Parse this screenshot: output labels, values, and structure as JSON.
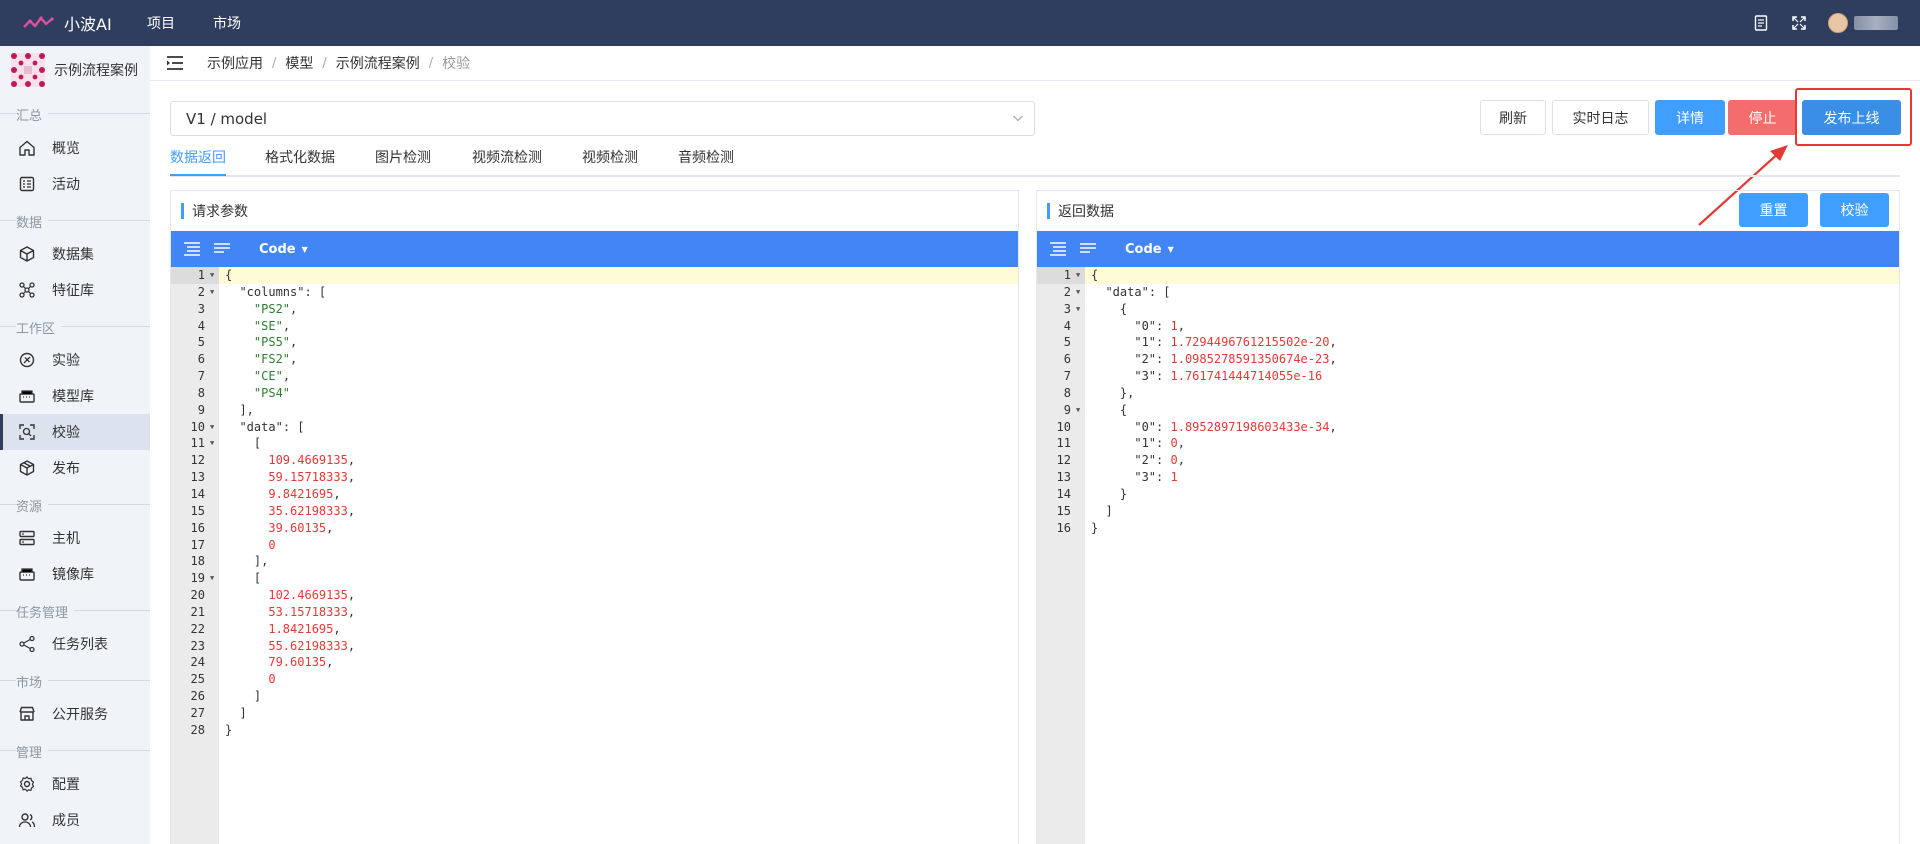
{
  "topbar": {
    "brand": "小波AI",
    "nav": [
      "项目",
      "市场"
    ],
    "icons": [
      "document-icon",
      "fullscreen-icon"
    ]
  },
  "sidebar": {
    "project_name": "示例流程案例",
    "groups": [
      {
        "title": "汇总",
        "items": [
          {
            "label": "概览",
            "icon": "home-icon"
          },
          {
            "label": "活动",
            "icon": "activity-icon"
          }
        ]
      },
      {
        "title": "数据",
        "items": [
          {
            "label": "数据集",
            "icon": "cube-icon"
          },
          {
            "label": "特征库",
            "icon": "feature-icon"
          }
        ]
      },
      {
        "title": "工作区",
        "items": [
          {
            "label": "实验",
            "icon": "experiment-icon"
          },
          {
            "label": "模型库",
            "icon": "model-icon"
          },
          {
            "label": "校验",
            "icon": "scan-icon"
          },
          {
            "label": "发布",
            "icon": "publish-icon"
          }
        ]
      },
      {
        "title": "资源",
        "items": [
          {
            "label": "主机",
            "icon": "server-icon"
          },
          {
            "label": "镜像库",
            "icon": "image-repo-icon"
          }
        ]
      },
      {
        "title": "任务管理",
        "items": [
          {
            "label": "任务列表",
            "icon": "tasks-icon"
          }
        ]
      },
      {
        "title": "市场",
        "items": [
          {
            "label": "公开服务",
            "icon": "store-icon"
          }
        ]
      },
      {
        "title": "管理",
        "items": [
          {
            "label": "配置",
            "icon": "settings-icon"
          },
          {
            "label": "成员",
            "icon": "members-icon"
          }
        ]
      }
    ],
    "active_item": "校验"
  },
  "breadcrumb": [
    "示例应用",
    "模型",
    "示例流程案例",
    "校验"
  ],
  "model_select": {
    "value": "V1 / model"
  },
  "actions": {
    "refresh": "刷新",
    "live_log": "实时日志",
    "details": "详情",
    "stop": "停止",
    "publish": "发布上线"
  },
  "tabs": [
    "数据返回",
    "格式化数据",
    "图片检测",
    "视频流检测",
    "视频检测",
    "音频检测"
  ],
  "request_panel": {
    "title": "请求参数",
    "toolbar_mode": "Code",
    "lines": [
      [
        {
          "t": "p",
          "v": "{"
        }
      ],
      [
        {
          "t": "p",
          "v": "  "
        },
        {
          "t": "k",
          "v": "\"columns\""
        },
        {
          "t": "p",
          "v": ": ["
        }
      ],
      [
        {
          "t": "p",
          "v": "    "
        },
        {
          "t": "s",
          "v": "\"PS2\""
        },
        {
          "t": "p",
          "v": ","
        }
      ],
      [
        {
          "t": "p",
          "v": "    "
        },
        {
          "t": "s",
          "v": "\"SE\""
        },
        {
          "t": "p",
          "v": ","
        }
      ],
      [
        {
          "t": "p",
          "v": "    "
        },
        {
          "t": "s",
          "v": "\"PS5\""
        },
        {
          "t": "p",
          "v": ","
        }
      ],
      [
        {
          "t": "p",
          "v": "    "
        },
        {
          "t": "s",
          "v": "\"FS2\""
        },
        {
          "t": "p",
          "v": ","
        }
      ],
      [
        {
          "t": "p",
          "v": "    "
        },
        {
          "t": "s",
          "v": "\"CE\""
        },
        {
          "t": "p",
          "v": ","
        }
      ],
      [
        {
          "t": "p",
          "v": "    "
        },
        {
          "t": "s",
          "v": "\"PS4\""
        }
      ],
      [
        {
          "t": "p",
          "v": "  ],"
        }
      ],
      [
        {
          "t": "p",
          "v": "  "
        },
        {
          "t": "k",
          "v": "\"data\""
        },
        {
          "t": "p",
          "v": ": ["
        }
      ],
      [
        {
          "t": "p",
          "v": "    ["
        }
      ],
      [
        {
          "t": "p",
          "v": "      "
        },
        {
          "t": "n",
          "v": "109.4669135"
        },
        {
          "t": "p",
          "v": ","
        }
      ],
      [
        {
          "t": "p",
          "v": "      "
        },
        {
          "t": "n",
          "v": "59.15718333"
        },
        {
          "t": "p",
          "v": ","
        }
      ],
      [
        {
          "t": "p",
          "v": "      "
        },
        {
          "t": "n",
          "v": "9.8421695"
        },
        {
          "t": "p",
          "v": ","
        }
      ],
      [
        {
          "t": "p",
          "v": "      "
        },
        {
          "t": "n",
          "v": "35.62198333"
        },
        {
          "t": "p",
          "v": ","
        }
      ],
      [
        {
          "t": "p",
          "v": "      "
        },
        {
          "t": "n",
          "v": "39.60135"
        },
        {
          "t": "p",
          "v": ","
        }
      ],
      [
        {
          "t": "p",
          "v": "      "
        },
        {
          "t": "n",
          "v": "0"
        }
      ],
      [
        {
          "t": "p",
          "v": "    ],"
        }
      ],
      [
        {
          "t": "p",
          "v": "    ["
        }
      ],
      [
        {
          "t": "p",
          "v": "      "
        },
        {
          "t": "n",
          "v": "102.4669135"
        },
        {
          "t": "p",
          "v": ","
        }
      ],
      [
        {
          "t": "p",
          "v": "      "
        },
        {
          "t": "n",
          "v": "53.15718333"
        },
        {
          "t": "p",
          "v": ","
        }
      ],
      [
        {
          "t": "p",
          "v": "      "
        },
        {
          "t": "n",
          "v": "1.8421695"
        },
        {
          "t": "p",
          "v": ","
        }
      ],
      [
        {
          "t": "p",
          "v": "      "
        },
        {
          "t": "n",
          "v": "55.62198333"
        },
        {
          "t": "p",
          "v": ","
        }
      ],
      [
        {
          "t": "p",
          "v": "      "
        },
        {
          "t": "n",
          "v": "79.60135"
        },
        {
          "t": "p",
          "v": ","
        }
      ],
      [
        {
          "t": "p",
          "v": "      "
        },
        {
          "t": "n",
          "v": "0"
        }
      ],
      [
        {
          "t": "p",
          "v": "    ]"
        }
      ],
      [
        {
          "t": "p",
          "v": "  ]"
        }
      ],
      [
        {
          "t": "p",
          "v": "}"
        }
      ]
    ],
    "fold_lines": [
      1,
      2,
      10,
      11,
      19
    ]
  },
  "response_panel": {
    "title": "返回数据",
    "toolbar_mode": "Code",
    "reset": "重置",
    "validate": "校验",
    "lines": [
      [
        {
          "t": "p",
          "v": "{"
        }
      ],
      [
        {
          "t": "p",
          "v": "  "
        },
        {
          "t": "k",
          "v": "\"data\""
        },
        {
          "t": "p",
          "v": ": ["
        }
      ],
      [
        {
          "t": "p",
          "v": "    {"
        }
      ],
      [
        {
          "t": "p",
          "v": "      "
        },
        {
          "t": "k",
          "v": "\"0\""
        },
        {
          "t": "p",
          "v": ": "
        },
        {
          "t": "n",
          "v": "1"
        },
        {
          "t": "p",
          "v": ","
        }
      ],
      [
        {
          "t": "p",
          "v": "      "
        },
        {
          "t": "k",
          "v": "\"1\""
        },
        {
          "t": "p",
          "v": ": "
        },
        {
          "t": "n",
          "v": "1.7294496761215502e-20"
        },
        {
          "t": "p",
          "v": ","
        }
      ],
      [
        {
          "t": "p",
          "v": "      "
        },
        {
          "t": "k",
          "v": "\"2\""
        },
        {
          "t": "p",
          "v": ": "
        },
        {
          "t": "n",
          "v": "1.0985278591350674e-23"
        },
        {
          "t": "p",
          "v": ","
        }
      ],
      [
        {
          "t": "p",
          "v": "      "
        },
        {
          "t": "k",
          "v": "\"3\""
        },
        {
          "t": "p",
          "v": ": "
        },
        {
          "t": "n",
          "v": "1.761741444714055e-16"
        }
      ],
      [
        {
          "t": "p",
          "v": "    },"
        }
      ],
      [
        {
          "t": "p",
          "v": "    {"
        }
      ],
      [
        {
          "t": "p",
          "v": "      "
        },
        {
          "t": "k",
          "v": "\"0\""
        },
        {
          "t": "p",
          "v": ": "
        },
        {
          "t": "n",
          "v": "1.8952897198603433e-34"
        },
        {
          "t": "p",
          "v": ","
        }
      ],
      [
        {
          "t": "p",
          "v": "      "
        },
        {
          "t": "k",
          "v": "\"1\""
        },
        {
          "t": "p",
          "v": ": "
        },
        {
          "t": "n",
          "v": "0"
        },
        {
          "t": "p",
          "v": ","
        }
      ],
      [
        {
          "t": "p",
          "v": "      "
        },
        {
          "t": "k",
          "v": "\"2\""
        },
        {
          "t": "p",
          "v": ": "
        },
        {
          "t": "n",
          "v": "0"
        },
        {
          "t": "p",
          "v": ","
        }
      ],
      [
        {
          "t": "p",
          "v": "      "
        },
        {
          "t": "k",
          "v": "\"3\""
        },
        {
          "t": "p",
          "v": ": "
        },
        {
          "t": "n",
          "v": "1"
        }
      ],
      [
        {
          "t": "p",
          "v": "    }"
        }
      ],
      [
        {
          "t": "p",
          "v": "  ]"
        }
      ],
      [
        {
          "t": "p",
          "v": "}"
        }
      ]
    ],
    "fold_lines": [
      1,
      2,
      3,
      9
    ]
  },
  "colors": {
    "topbar": "#2f3d5f",
    "accent": "#409eff",
    "danger": "#f56c6c",
    "annotation": "#e53935"
  }
}
